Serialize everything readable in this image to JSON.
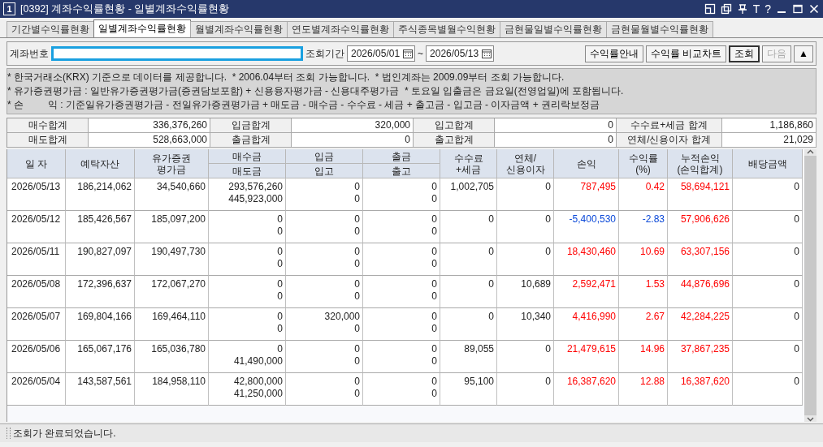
{
  "window": {
    "number": "1",
    "title": "[0392] 계좌수익률현황 - 일별계좌수익률현황",
    "buttons": [
      "T",
      "?"
    ]
  },
  "tabs": [
    {
      "label": "기간별수익률현황",
      "selected": false
    },
    {
      "label": "일별계좌수익률현황",
      "selected": true
    },
    {
      "label": "월별계좌수익률현황",
      "selected": false
    },
    {
      "label": "연도별계좌수익률현황",
      "selected": false
    },
    {
      "label": "주식종목별월수익현황",
      "selected": false
    },
    {
      "label": "금현물일별수익률현황",
      "selected": false
    },
    {
      "label": "금현물월별수익률현황",
      "selected": false
    }
  ],
  "toolbar": {
    "account_label": "계좌번호",
    "account_masked": true,
    "period_label": "조회기간",
    "date_from": "2026/05/01",
    "separator": "~",
    "date_to": "2026/05/13",
    "buttons": [
      {
        "label": "수익률안내",
        "default": false,
        "disabled": false
      },
      {
        "label": "수익률 비교차트",
        "default": false,
        "disabled": false
      },
      {
        "label": "조회",
        "default": true,
        "disabled": false
      },
      {
        "label": "다음",
        "default": false,
        "disabled": true
      },
      {
        "label": "▲",
        "default": false,
        "disabled": false
      }
    ]
  },
  "notes": [
    "* 한국거래소(KRX) 기준으로 데이터를 제공합니다.  * 2006.04부터 조회 가능합니다.  * 법인계좌는 2009.09부터 조회 가능합니다.",
    "* 유가증권평가금 : 일반유가증권평가금(증권담보포함) + 신용융자평가금 - 신용대주평가금  * 토요일 입출금은 금요일(전영업일)에 포함됩니다.",
    "* 손         익 : 기준일유가증권평가금 - 전일유가증권평가금 + 매도금 - 매수금 - 수수료 - 세금 + 출고금 - 입고금 - 이자금액 + 권리락보정금"
  ],
  "summary": [
    [
      {
        "label": "매수합계",
        "value": "336,376,260"
      },
      {
        "label": "입금합계",
        "value": "320,000"
      },
      {
        "label": "입고합계",
        "value": "0"
      },
      {
        "label": "수수료+세금 합계",
        "value": "1,186,860"
      }
    ],
    [
      {
        "label": "매도합계",
        "value": "528,663,000"
      },
      {
        "label": "출금합계",
        "value": "0"
      },
      {
        "label": "출고합계",
        "value": "0"
      },
      {
        "label": "연체/신용이자 합계",
        "value": "21,029"
      }
    ]
  ],
  "table": {
    "columns": [
      {
        "label": "일 자"
      },
      {
        "label": "예탁자산"
      },
      {
        "label": "유가증권\n평가금"
      },
      {
        "label": "매수금",
        "sub": "매도금"
      },
      {
        "label": "입금",
        "sub": "입고"
      },
      {
        "label": "출금",
        "sub": "출고"
      },
      {
        "label": "수수료\n+세금"
      },
      {
        "label": "연체/\n신용이자"
      },
      {
        "label": "손익"
      },
      {
        "label": "수익률\n(%)"
      },
      {
        "label": "누적손익\n(손익합계)"
      },
      {
        "label": "배당금액"
      }
    ],
    "rows": [
      {
        "date": "2026/05/13",
        "assets": "186,214,062",
        "securities": "34,540,660",
        "buy": "293,576,260",
        "sell": "445,923,000",
        "deposit": "0",
        "stock_in": "0",
        "withdrawal": "0",
        "stock_out": "0",
        "fee_tax": "1,002,705",
        "interest": "0",
        "profit": "787,495",
        "profit_negative": false,
        "rate": "0.42",
        "rate_negative": false,
        "cumulative": "58,694,121",
        "cumulative_negative": false,
        "dividend": "0"
      },
      {
        "date": "2026/05/12",
        "assets": "185,426,567",
        "securities": "185,097,200",
        "buy": "0",
        "sell": "0",
        "deposit": "0",
        "stock_in": "0",
        "withdrawal": "0",
        "stock_out": "0",
        "fee_tax": "0",
        "interest": "0",
        "profit": "-5,400,530",
        "profit_negative": true,
        "rate": "-2.83",
        "rate_negative": true,
        "cumulative": "57,906,626",
        "cumulative_negative": false,
        "dividend": "0"
      },
      {
        "date": "2026/05/11",
        "assets": "190,827,097",
        "securities": "190,497,730",
        "buy": "0",
        "sell": "0",
        "deposit": "0",
        "stock_in": "0",
        "withdrawal": "0",
        "stock_out": "0",
        "fee_tax": "0",
        "interest": "0",
        "profit": "18,430,460",
        "profit_negative": false,
        "rate": "10.69",
        "rate_negative": false,
        "cumulative": "63,307,156",
        "cumulative_negative": false,
        "dividend": "0"
      },
      {
        "date": "2026/05/08",
        "assets": "172,396,637",
        "securities": "172,067,270",
        "buy": "0",
        "sell": "0",
        "deposit": "0",
        "stock_in": "0",
        "withdrawal": "0",
        "stock_out": "0",
        "fee_tax": "0",
        "interest": "10,689",
        "profit": "2,592,471",
        "profit_negative": false,
        "rate": "1.53",
        "rate_negative": false,
        "cumulative": "44,876,696",
        "cumulative_negative": false,
        "dividend": "0"
      },
      {
        "date": "2026/05/07",
        "assets": "169,804,166",
        "securities": "169,464,110",
        "buy": "0",
        "sell": "0",
        "deposit": "320,000",
        "stock_in": "0",
        "withdrawal": "0",
        "stock_out": "0",
        "fee_tax": "0",
        "interest": "10,340",
        "profit": "4,416,990",
        "profit_negative": false,
        "rate": "2.67",
        "rate_negative": false,
        "cumulative": "42,284,225",
        "cumulative_negative": false,
        "dividend": "0"
      },
      {
        "date": "2026/05/06",
        "assets": "165,067,176",
        "securities": "165,036,780",
        "buy": "0",
        "sell": "41,490,000",
        "deposit": "0",
        "stock_in": "0",
        "withdrawal": "0",
        "stock_out": "0",
        "fee_tax": "89,055",
        "interest": "0",
        "profit": "21,479,615",
        "profit_negative": false,
        "rate": "14.96",
        "rate_negative": false,
        "cumulative": "37,867,235",
        "cumulative_negative": false,
        "dividend": "0"
      },
      {
        "date": "2026/05/04",
        "assets": "143,587,561",
        "securities": "184,958,110",
        "buy": "42,800,000",
        "sell": "41,250,000",
        "deposit": "0",
        "stock_in": "0",
        "withdrawal": "0",
        "stock_out": "0",
        "fee_tax": "95,100",
        "interest": "0",
        "profit": "16,387,620",
        "profit_negative": false,
        "rate": "12.88",
        "rate_negative": false,
        "cumulative": "16,387,620",
        "cumulative_negative": false,
        "dividend": "0"
      }
    ]
  },
  "status": "조회가 완료되었습니다."
}
